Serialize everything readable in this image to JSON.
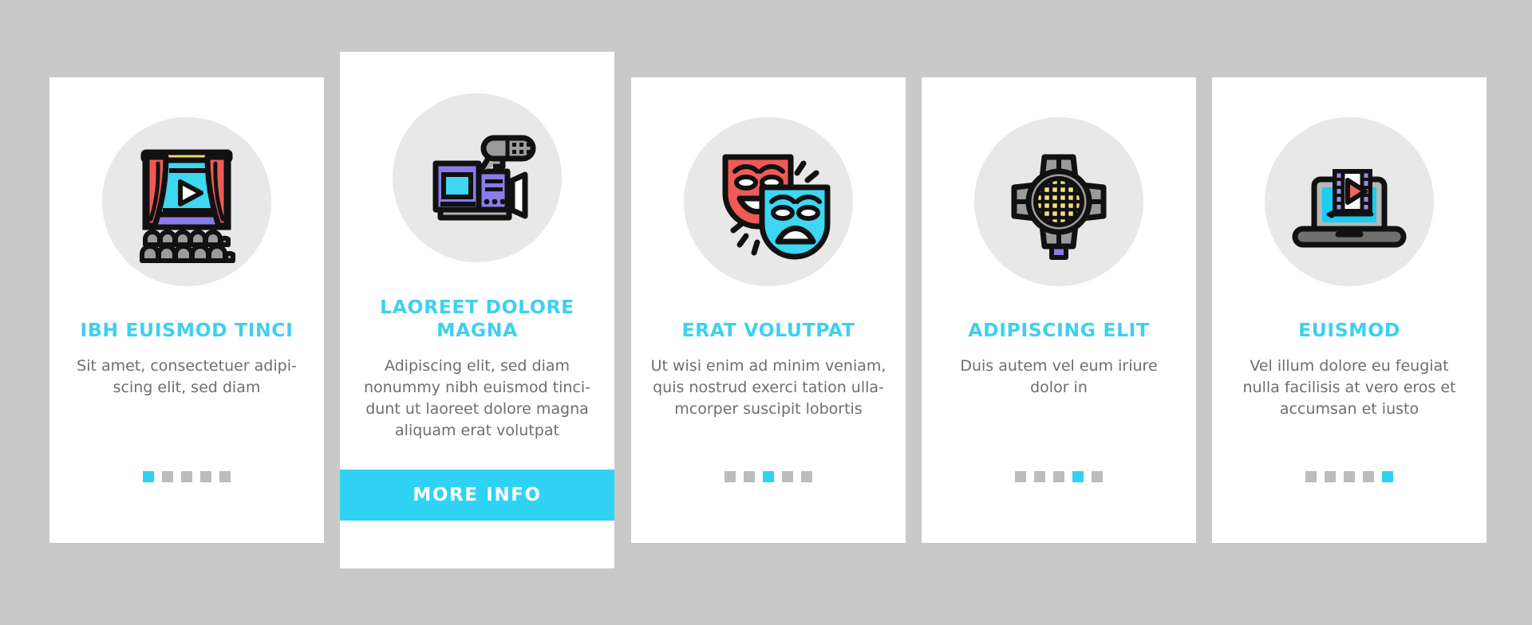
{
  "background_color": "#c9c9c9",
  "accent_color": "#2fd2f2",
  "title_color": "#3ed0ef",
  "body_text_color": "#6d6e71",
  "icon_circle_color": "#e8e8e8",
  "cards": [
    {
      "icon": "cinema-screen-icon",
      "title": "IBH EUISMOD TINCI",
      "description": "Sit amet, consectetuer adipi-scing elit, sed diam",
      "dots": {
        "count": 5,
        "active_index": 1
      },
      "has_button": false
    },
    {
      "icon": "video-camera-icon",
      "title": "LAOREET DOLORE MAGNA",
      "description": "Adipiscing elit, sed diam nonummy nibh euismod tinci-dunt ut laoreet dolore magna aliquam erat volutpat",
      "has_button": true,
      "button_label": "MORE INFO"
    },
    {
      "icon": "theater-masks-icon",
      "title": "ERAT VOLUTPAT",
      "description": "Ut wisi enim ad minim veniam, quis nostrud exerci tation ulla-mcorper suscipit lobortis",
      "dots": {
        "count": 5,
        "active_index": 3
      },
      "has_button": false
    },
    {
      "icon": "stage-spotlight-icon",
      "title": "ADIPISCING ELIT",
      "description": "Duis autem vel eum iriure dolor in",
      "dots": {
        "count": 5,
        "active_index": 4
      },
      "has_button": false
    },
    {
      "icon": "laptop-video-icon",
      "title": "EUISMOD",
      "description": "Vel illum dolore eu feugiat nulla facilisis at vero eros et accumsan et iusto",
      "dots": {
        "count": 5,
        "active_index": 5
      },
      "has_button": false
    }
  ]
}
